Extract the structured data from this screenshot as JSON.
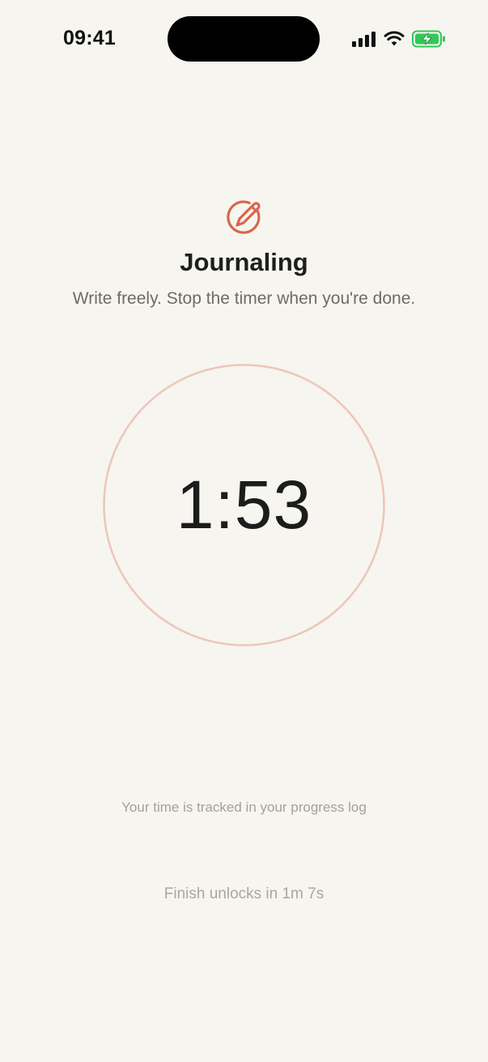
{
  "status_bar": {
    "time": "09:41",
    "icons": [
      "signal-icon",
      "wifi-icon",
      "battery-charging-icon"
    ],
    "battery_color": "#34C759"
  },
  "header": {
    "icon": "pencil-circle-icon",
    "accent_color": "#D9664A",
    "title": "Journaling",
    "subtitle": "Write freely. Stop the timer when you're done."
  },
  "timer": {
    "display": "1:53",
    "ring_color": "#EDC6B8"
  },
  "footer": {
    "tracked_note": "Your time is tracked in your progress log",
    "finish_note": "Finish unlocks in 1m 7s"
  }
}
